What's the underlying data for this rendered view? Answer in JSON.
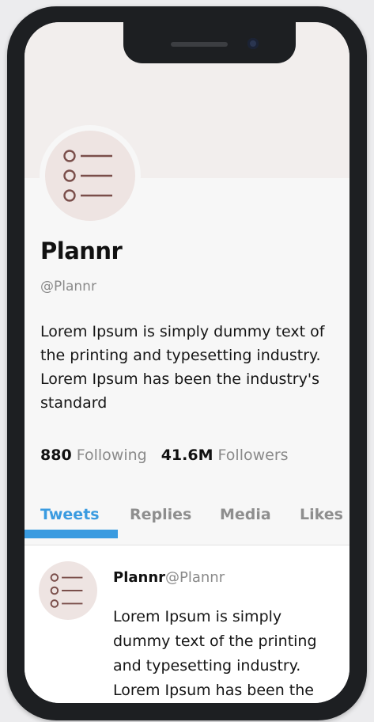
{
  "profile": {
    "name": "Plannr",
    "handle": "@Plannr",
    "bio": "Lorem Ipsum is simply dummy text of the printing and typesetting industry. Lorem Ipsum has been the industry's standard",
    "avatar_icon": "list-icon"
  },
  "stats": {
    "following_count": "880",
    "following_label": "Following",
    "followers_count": "41.6M",
    "followers_label": "Followers"
  },
  "tabs": [
    {
      "label": "Tweets",
      "active": true
    },
    {
      "label": "Replies",
      "active": false
    },
    {
      "label": "Media",
      "active": false
    },
    {
      "label": "Likes",
      "active": false
    }
  ],
  "tweet": {
    "name": "Plannr",
    "handle": "@Plannr",
    "text": "Lorem Ipsum is simply dummy text of the printing and typesetting industry. Lorem Ipsum has been the",
    "avatar_icon": "list-icon"
  },
  "colors": {
    "accent": "#3a9be0",
    "icon": "#7a4e4a",
    "cover": "#f2eeed",
    "avatar_bg": "#eee4e2"
  }
}
